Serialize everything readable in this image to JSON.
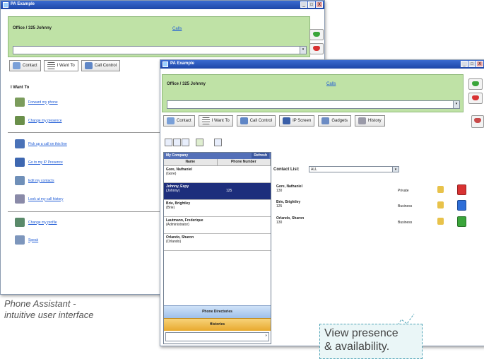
{
  "colors": {
    "titlebar": "#1d46a8",
    "green_panel": "#bfe2a6",
    "link": "#1e5bd6",
    "selected_row": "#1d2e7c",
    "callout_border": "#4ea3b6",
    "presence_available": "#3aa53a",
    "presence_busy": "#d83232",
    "presence_away": "#2e6ed8"
  },
  "back_window": {
    "title": "PA Example",
    "title_buttons": [
      "_",
      "□",
      "X"
    ],
    "status": "Office / 325 Johnny",
    "info_link": "Calls",
    "dial_value": "",
    "tabs": [
      {
        "label": "Contact",
        "icon": "contact-card-icon"
      },
      {
        "label": "I Want To",
        "icon": "list-icon"
      },
      {
        "label": "Call Control",
        "icon": "phone-icon"
      }
    ],
    "want_heading": "I Want To",
    "want_items": [
      {
        "label": "Forward my phone",
        "icon": "forward-icon"
      },
      {
        "label": "Change my presence",
        "icon": "presence-icon"
      },
      {
        "label": "Pick up a call on this line",
        "icon": "pickup-icon"
      },
      {
        "label": "Go to my IP Presence",
        "icon": "ip-phone-icon"
      },
      {
        "label": "Edit my contacts",
        "icon": "contacts-icon"
      },
      {
        "label": "Look at my call history",
        "icon": "history-icon"
      },
      {
        "label": "Change my profile",
        "icon": "profile-icon"
      },
      {
        "label": "Speak",
        "icon": "speak-icon"
      }
    ]
  },
  "front_window": {
    "title": "PA Example",
    "title_buttons": [
      "_",
      "□",
      "X"
    ],
    "status": "Office / 325 Johnny",
    "info_link": "Calls",
    "tabs": [
      {
        "label": "Contact",
        "icon": "contact-card-icon"
      },
      {
        "label": "I Want To",
        "icon": "list-icon"
      },
      {
        "label": "Call Control",
        "icon": "phone-icon"
      },
      {
        "label": "IP Screen",
        "icon": "monitor-icon"
      },
      {
        "label": "Gadgets",
        "icon": "gadget-icon"
      },
      {
        "label": "History",
        "icon": "history-icon"
      }
    ],
    "contacts_panel": {
      "header_left": "My Company",
      "header_right": "Refresh",
      "columns": [
        "Name",
        "Phone Number"
      ],
      "rows": [
        {
          "name": "Gore, Nathaniel",
          "sub": "(Gore)",
          "num": ""
        },
        {
          "name": "Johnny, Espy",
          "sub": "(Johnny)",
          "num": "125",
          "selected": true
        },
        {
          "name": "Brie, Brightley",
          "sub": "(Brie)",
          "num": ""
        },
        {
          "name": "Lautmann, Frederique",
          "sub": "(Administrator)",
          "num": ""
        },
        {
          "name": "Orlando, Sharon",
          "sub": "(Orlando)",
          "num": ""
        }
      ],
      "phone_directory_button": "Phone Directories",
      "history_button": "Histories",
      "search_value": ""
    },
    "contact_list_label": "Contact List:",
    "contact_list_select": "ALL",
    "contact_entries": [
      {
        "name": "Gore, Nathaniel",
        "num": "130",
        "status": "Private",
        "presence": "busy"
      },
      {
        "name": "Brie, Brightley",
        "num": "125",
        "status": "Business",
        "presence": "away"
      },
      {
        "name": "Orlando, Sharon",
        "num": "130",
        "status": "Business",
        "presence": "available"
      }
    ]
  },
  "caption": {
    "line1": "Phone Assistant -",
    "line2": "intuitive user interface"
  },
  "callout": {
    "line1": "View presence",
    "line2": "& availability."
  }
}
